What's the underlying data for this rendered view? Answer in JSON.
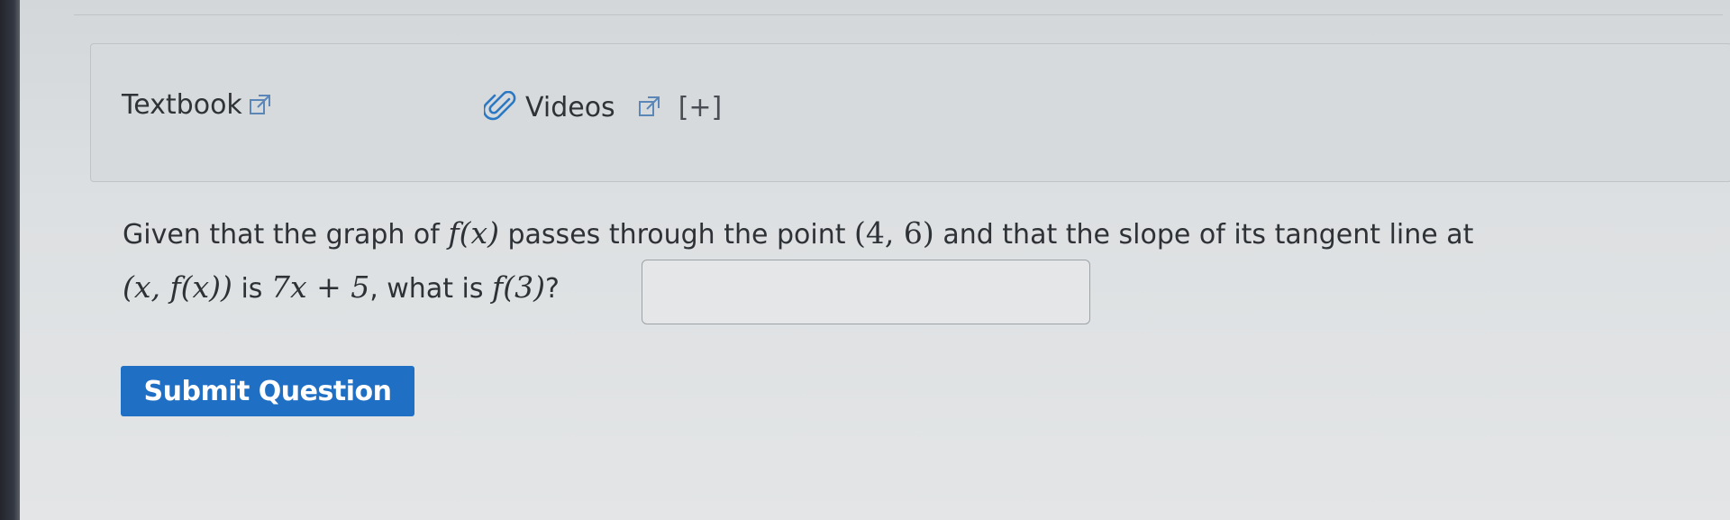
{
  "resources": {
    "textbook_label": "Textbook",
    "videos_label": "Videos",
    "expand_label": "[+]"
  },
  "question": {
    "part1": "Given that the graph of ",
    "part2": " passes through the point ",
    "part3": " and that the slope of its tangent line at",
    "part4": " is ",
    "part5": ", what is ",
    "part6": "?",
    "math_fx": "f(x)",
    "math_point": "(4, 6)",
    "math_xfx": "(x, f(x))",
    "math_slope": "7x + 5",
    "math_f3": "f(3)"
  },
  "answer": {
    "value": ""
  },
  "actions": {
    "submit_label": "Submit Question"
  },
  "colors": {
    "accent": "#1f6fc4",
    "panel_bg": "#d7dadc"
  }
}
